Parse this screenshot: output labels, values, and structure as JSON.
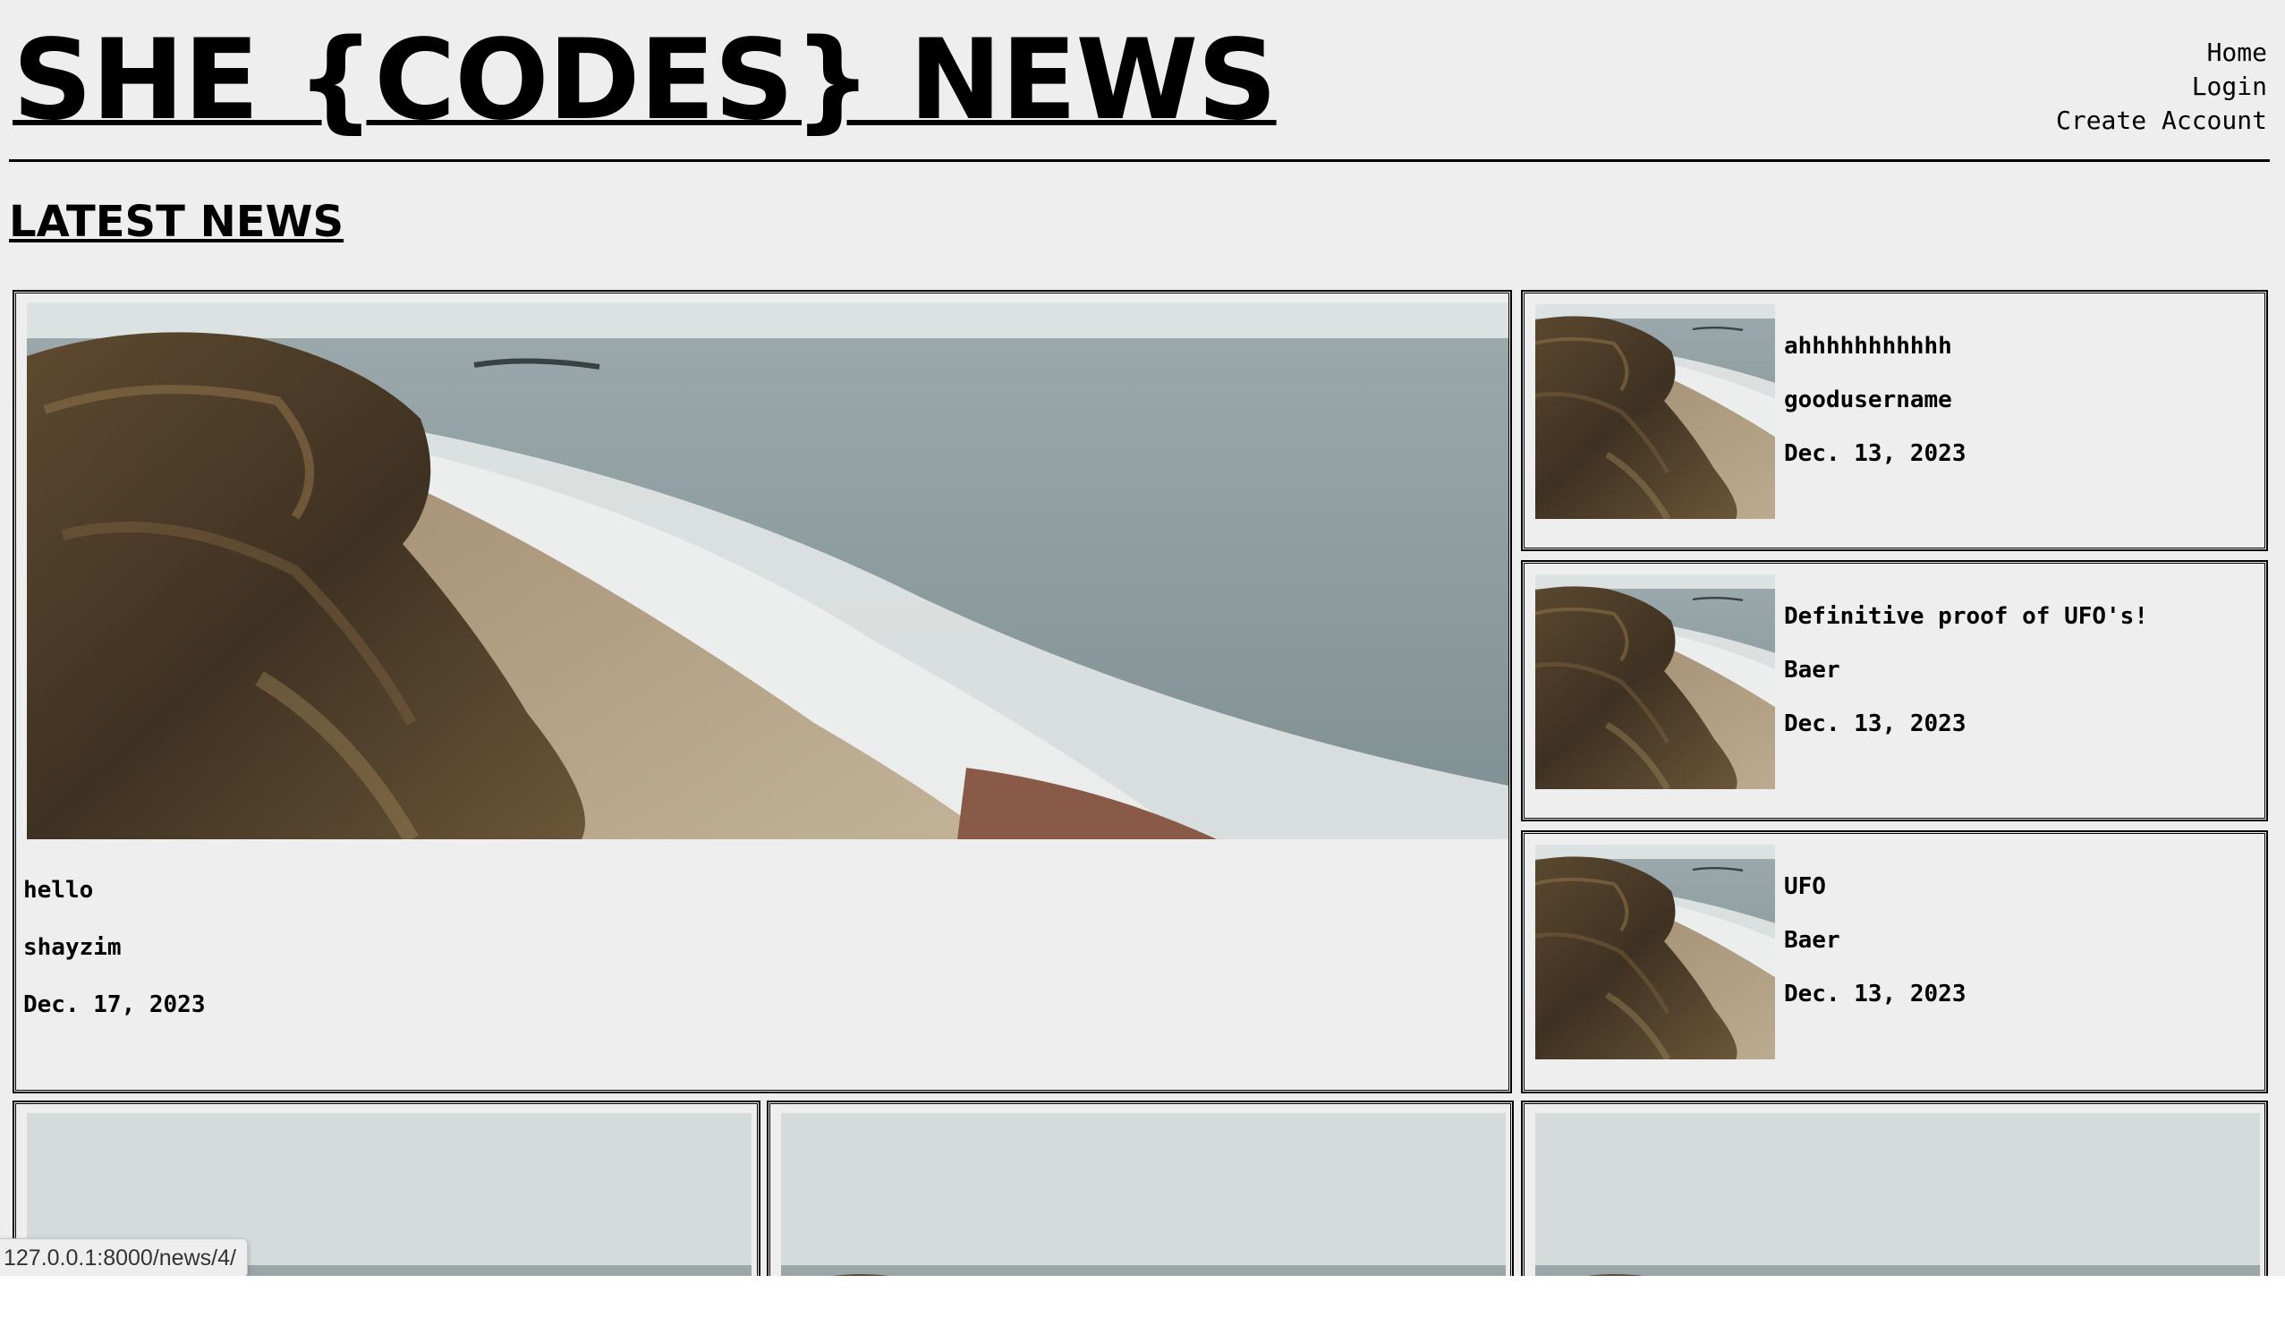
{
  "header": {
    "site_title": "SHE {CODES} NEWS",
    "nav": {
      "home": "Home",
      "login": "Login",
      "create_account": "Create Account"
    }
  },
  "section_title": "LATEST NEWS",
  "featured": {
    "title": "hello",
    "author": "shayzim",
    "date": "Dec. 17, 2023"
  },
  "side_stories": [
    {
      "title": "ahhhhhhhhhhh",
      "author": "goodusername",
      "date": "Dec. 13, 2023"
    },
    {
      "title": "Definitive proof of UFO's!",
      "author": "Baer",
      "date": "Dec. 13, 2023"
    },
    {
      "title": "UFO",
      "author": "Baer",
      "date": "Dec. 13, 2023"
    }
  ],
  "status_bar": {
    "url": "127.0.0.1:8000/news/4/"
  },
  "colors": {
    "background": "#eeeeee",
    "text": "#000000",
    "border": "#000000"
  }
}
